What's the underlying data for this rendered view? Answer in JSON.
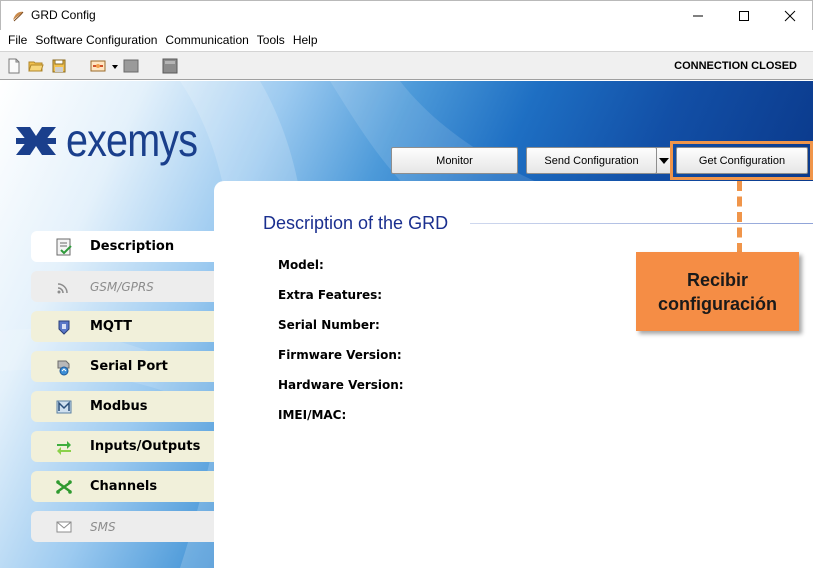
{
  "window": {
    "title": "GRD Config",
    "controls": [
      "minimize-icon",
      "maximize-icon",
      "close-icon"
    ]
  },
  "menu": [
    {
      "label": "File"
    },
    {
      "label": "Software Configuration"
    },
    {
      "label": "Communication"
    },
    {
      "label": "Tools"
    },
    {
      "label": "Help"
    }
  ],
  "toolbar": {
    "icons": [
      "new-file-icon",
      "open-folder-icon",
      "save-icon",
      "connect-icon",
      "dropdown-arrow-icon",
      "disconnect-icon",
      "device-icon"
    ],
    "connection_status": "CONNECTION CLOSED"
  },
  "brand": {
    "logo_text": "exemys",
    "color": "#1a3f8c"
  },
  "actions": {
    "monitor": "Monitor",
    "send_configuration": "Send Configuration",
    "get_configuration": "Get Configuration"
  },
  "sidebar": {
    "tabs": [
      {
        "label": "Description",
        "icon": "description-icon",
        "state": "active"
      },
      {
        "label": "GSM/GPRS",
        "icon": "wireless-icon",
        "state": "disabled"
      },
      {
        "label": "MQTT",
        "icon": "mqtt-icon",
        "state": "normal"
      },
      {
        "label": "Serial Port",
        "icon": "serial-port-icon",
        "state": "normal"
      },
      {
        "label": "Modbus",
        "icon": "modbus-icon",
        "state": "normal"
      },
      {
        "label": "Inputs/Outputs",
        "icon": "inputs-outputs-icon",
        "state": "normal"
      },
      {
        "label": "Channels",
        "icon": "channels-icon",
        "state": "normal"
      },
      {
        "label": "SMS",
        "icon": "sms-icon",
        "state": "disabled"
      }
    ]
  },
  "content": {
    "title": "Description of the GRD",
    "fields": [
      {
        "label": "Model:"
      },
      {
        "label": "Extra Features:"
      },
      {
        "label": "Serial Number:"
      },
      {
        "label": "Firmware Version:"
      },
      {
        "label": "Hardware Version:"
      },
      {
        "label": "IMEI/MAC:"
      }
    ]
  },
  "annotation": {
    "line1": "Recibir",
    "line2": "configuración",
    "color": "#f58d45"
  }
}
